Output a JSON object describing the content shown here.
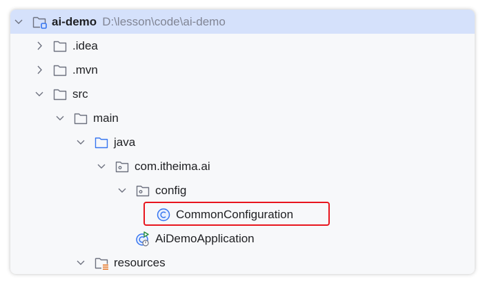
{
  "tree": [
    {
      "label": "ai-demo",
      "path": "D:\\lesson\\code\\ai-demo",
      "level": 0,
      "expanded": true,
      "icon": "module-folder-icon",
      "selected": true
    },
    {
      "label": ".idea",
      "level": 1,
      "expanded": false,
      "icon": "folder-icon"
    },
    {
      "label": ".mvn",
      "level": 1,
      "expanded": false,
      "icon": "folder-icon"
    },
    {
      "label": "src",
      "level": 1,
      "expanded": true,
      "icon": "folder-icon"
    },
    {
      "label": "main",
      "level": 2,
      "expanded": true,
      "icon": "folder-icon"
    },
    {
      "label": "java",
      "level": 3,
      "expanded": true,
      "icon": "source-folder-icon"
    },
    {
      "label": "com.itheima.ai",
      "level": 4,
      "expanded": true,
      "icon": "package-icon"
    },
    {
      "label": "config",
      "level": 5,
      "expanded": true,
      "icon": "package-icon"
    },
    {
      "label": "CommonConfiguration",
      "level": 6,
      "icon": "class-icon",
      "highlighted": true
    },
    {
      "label": "AiDemoApplication",
      "level": 5,
      "icon": "spring-boot-app-icon"
    },
    {
      "label": "resources",
      "level": 3,
      "expanded": true,
      "icon": "resources-folder-icon"
    }
  ],
  "colors": {
    "highlight": "#e8141c",
    "selection": "#d5e1fb",
    "accent": "#3574f0"
  }
}
